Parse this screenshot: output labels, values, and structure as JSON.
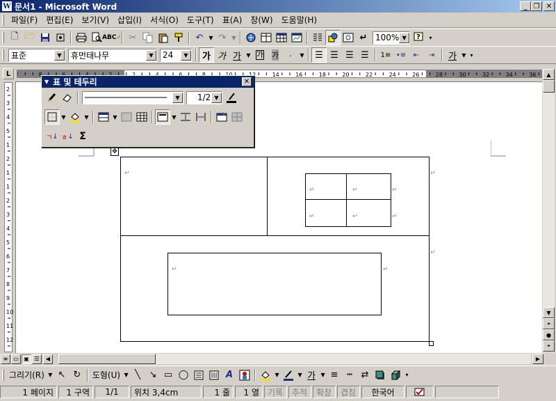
{
  "window": {
    "title": "문서1 - Microsoft Word",
    "icon": "W"
  },
  "menu": [
    "파일(F)",
    "편집(E)",
    "보기(V)",
    "삽입(I)",
    "서식(O)",
    "도구(T)",
    "표(A)",
    "창(W)",
    "도움말(H)"
  ],
  "standard_toolbar": {
    "zoom": "100%"
  },
  "format_toolbar": {
    "style": "표준",
    "font": "휴먼태나무",
    "size": "24"
  },
  "ruler_labels": [
    "8",
    "6",
    "4",
    "2",
    "2",
    "4",
    "6",
    "8",
    "10",
    "12",
    "14",
    "16",
    "18",
    "20",
    "22",
    "24",
    "26",
    "28",
    "30",
    "32",
    "34",
    "36"
  ],
  "vruler_labels": [
    "2",
    "3",
    "4",
    "5",
    "1",
    "2",
    "1",
    "1",
    "2",
    "3",
    "4",
    "5",
    "6",
    "7",
    "8",
    "9",
    "10",
    "11",
    "12"
  ],
  "tables_toolbar": {
    "title": "표 및 테두리",
    "line_weight": "1/2",
    "sum_glyph": "Σ"
  },
  "document": {
    "paragraph_mark": "↵"
  },
  "drawing_toolbar": {
    "draw_label": "그리기(R)",
    "autoshape_label": "도형(U)"
  },
  "status": {
    "page": "1 페이지",
    "section": "1 구역",
    "page_of": "1/1",
    "position": "위치 3,4cm",
    "line": "1 줄",
    "column": "1 열",
    "rec": "기록",
    "trk": "추적",
    "ext": "확장",
    "ovr": "겹침",
    "language": "한국어"
  }
}
